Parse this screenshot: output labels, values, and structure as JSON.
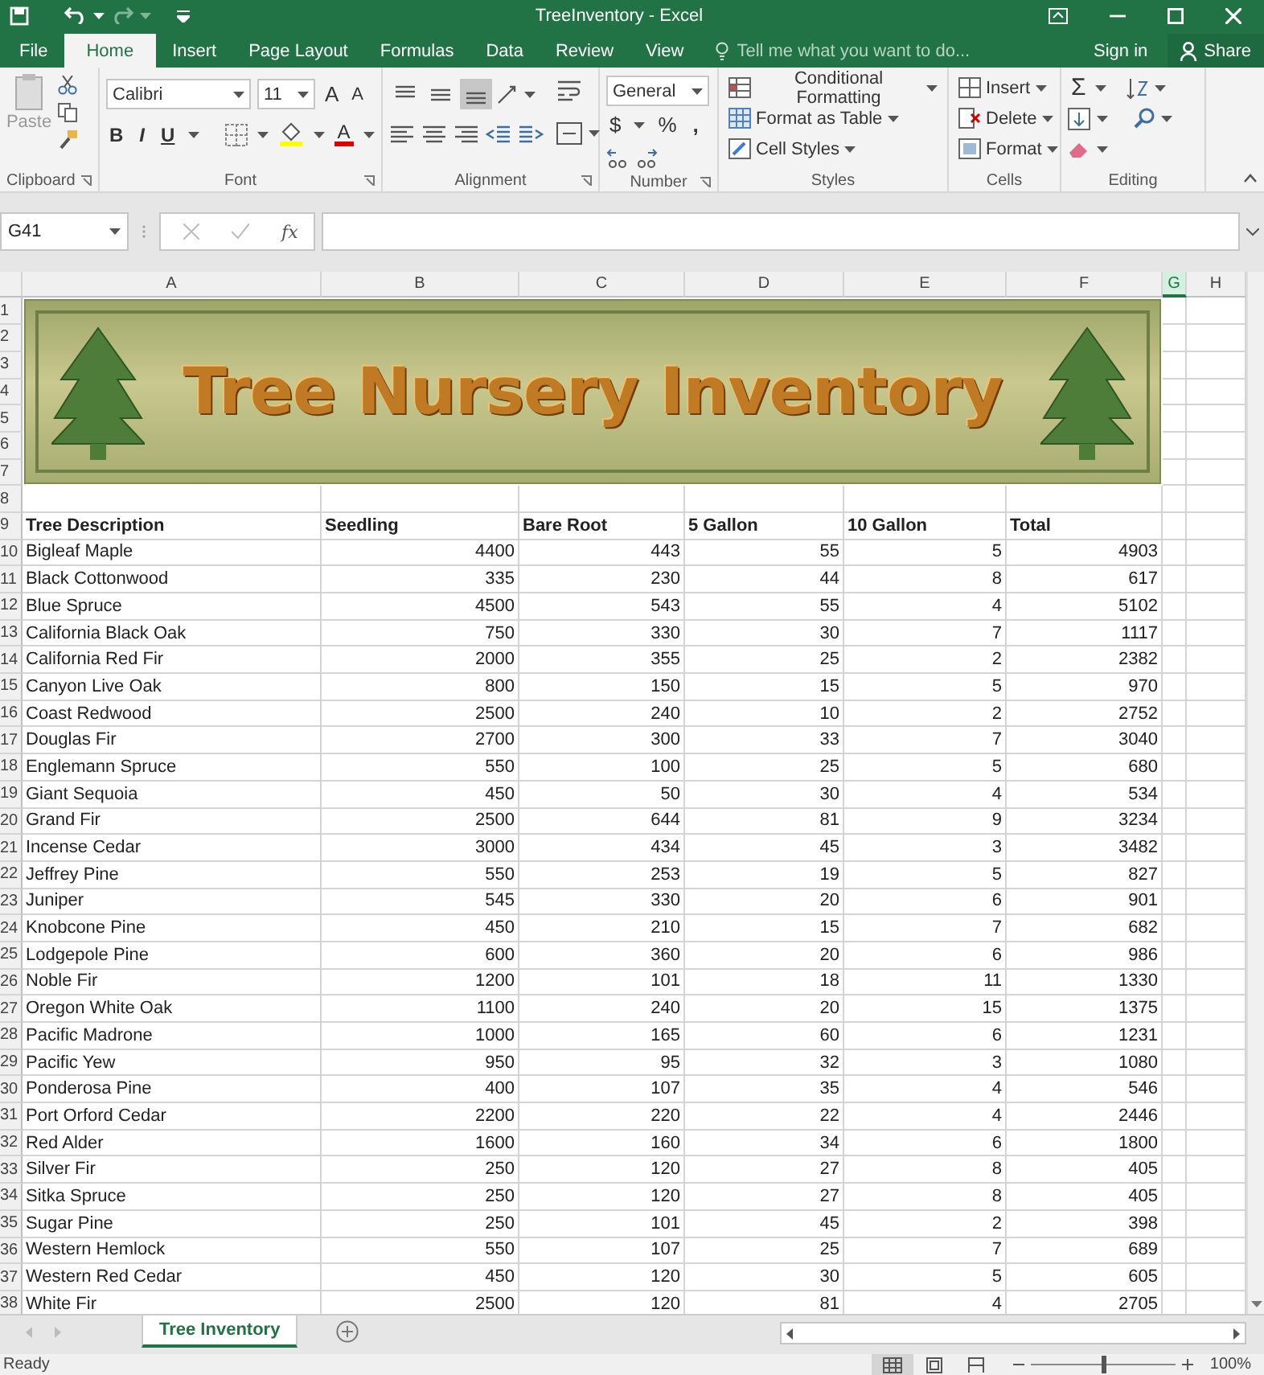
{
  "window": {
    "title": "TreeInventory - Excel"
  },
  "ribbon_tabs": [
    {
      "label": "File",
      "selected": false
    },
    {
      "label": "Home",
      "selected": true
    },
    {
      "label": "Insert",
      "selected": false
    },
    {
      "label": "Page Layout",
      "selected": false
    },
    {
      "label": "Formulas",
      "selected": false
    },
    {
      "label": "Data",
      "selected": false
    },
    {
      "label": "Review",
      "selected": false
    },
    {
      "label": "View",
      "selected": false
    }
  ],
  "tell_me": {
    "placeholder": "Tell me what you want to do..."
  },
  "account": {
    "sign_in": "Sign in",
    "share": "Share"
  },
  "ribbon": {
    "clipboard": {
      "label": "Clipboard",
      "paste": "Paste"
    },
    "font": {
      "label": "Font",
      "font_name": "Calibri",
      "font_size": "11",
      "grow": "A",
      "shrink": "A",
      "bold": "B",
      "italic": "I",
      "underline": "U",
      "font_color": "A"
    },
    "alignment": {
      "label": "Alignment",
      "vertical": [
        {
          "selected": false
        },
        {
          "selected": false
        },
        {
          "selected": true
        }
      ]
    },
    "number": {
      "label": "Number",
      "format": "General",
      "currency": "$",
      "percent": "%",
      "comma": ","
    },
    "styles": {
      "label": "Styles",
      "buttons": [
        "Conditional Formatting",
        "Format as Table",
        "Cell Styles"
      ]
    },
    "cells": {
      "label": "Cells",
      "buttons": [
        "Insert",
        "Delete",
        "Format"
      ]
    },
    "editing": {
      "label": "Editing",
      "autosum": "Σ"
    }
  },
  "formula_bar": {
    "name_box": "G41",
    "function": "fx"
  },
  "sheet": {
    "columns": [
      {
        "label": "A",
        "selected": false
      },
      {
        "label": "B",
        "selected": false
      },
      {
        "label": "C",
        "selected": false
      },
      {
        "label": "D",
        "selected": false
      },
      {
        "label": "E",
        "selected": false
      },
      {
        "label": "F",
        "selected": false
      },
      {
        "label": "G",
        "selected": true
      },
      {
        "label": "H",
        "selected": false
      }
    ],
    "banner": {
      "title": "Tree Nursery Inventory"
    },
    "rows": [
      {
        "number": "1",
        "kind": "empty"
      },
      {
        "number": "2",
        "kind": "empty"
      },
      {
        "number": "3",
        "kind": "empty"
      },
      {
        "number": "4",
        "kind": "empty"
      },
      {
        "number": "5",
        "kind": "empty"
      },
      {
        "number": "6",
        "kind": "empty"
      },
      {
        "number": "7",
        "kind": "empty"
      },
      {
        "number": "8",
        "kind": "empty"
      },
      {
        "number": "9",
        "kind": "header",
        "cells": [
          "Tree Description",
          "Seedling",
          "Bare Root",
          "5 Gallon",
          "10 Gallon",
          "Total"
        ]
      },
      {
        "number": "10",
        "kind": "data",
        "cells": [
          "Bigleaf Maple",
          "4400",
          "443",
          "55",
          "5",
          "4903"
        ]
      },
      {
        "number": "11",
        "kind": "data",
        "cells": [
          "Black Cottonwood",
          "335",
          "230",
          "44",
          "8",
          "617"
        ]
      },
      {
        "number": "12",
        "kind": "data",
        "cells": [
          "Blue Spruce",
          "4500",
          "543",
          "55",
          "4",
          "5102"
        ]
      },
      {
        "number": "13",
        "kind": "data",
        "cells": [
          "California Black Oak",
          "750",
          "330",
          "30",
          "7",
          "1117"
        ]
      },
      {
        "number": "14",
        "kind": "data",
        "cells": [
          "California Red Fir",
          "2000",
          "355",
          "25",
          "2",
          "2382"
        ]
      },
      {
        "number": "15",
        "kind": "data",
        "cells": [
          "Canyon Live Oak",
          "800",
          "150",
          "15",
          "5",
          "970"
        ]
      },
      {
        "number": "16",
        "kind": "data",
        "cells": [
          "Coast Redwood",
          "2500",
          "240",
          "10",
          "2",
          "2752"
        ]
      },
      {
        "number": "17",
        "kind": "data",
        "cells": [
          "Douglas Fir",
          "2700",
          "300",
          "33",
          "7",
          "3040"
        ]
      },
      {
        "number": "18",
        "kind": "data",
        "cells": [
          "Englemann Spruce",
          "550",
          "100",
          "25",
          "5",
          "680"
        ]
      },
      {
        "number": "19",
        "kind": "data",
        "cells": [
          "Giant Sequoia",
          "450",
          "50",
          "30",
          "4",
          "534"
        ]
      },
      {
        "number": "20",
        "kind": "data",
        "cells": [
          "Grand Fir",
          "2500",
          "644",
          "81",
          "9",
          "3234"
        ]
      },
      {
        "number": "21",
        "kind": "data",
        "cells": [
          "Incense Cedar",
          "3000",
          "434",
          "45",
          "3",
          "3482"
        ]
      },
      {
        "number": "22",
        "kind": "data",
        "cells": [
          "Jeffrey Pine",
          "550",
          "253",
          "19",
          "5",
          "827"
        ]
      },
      {
        "number": "23",
        "kind": "data",
        "cells": [
          "Juniper",
          "545",
          "330",
          "20",
          "6",
          "901"
        ]
      },
      {
        "number": "24",
        "kind": "data",
        "cells": [
          "Knobcone Pine",
          "450",
          "210",
          "15",
          "7",
          "682"
        ]
      },
      {
        "number": "25",
        "kind": "data",
        "cells": [
          "Lodgepole Pine",
          "600",
          "360",
          "20",
          "6",
          "986"
        ]
      },
      {
        "number": "26",
        "kind": "data",
        "cells": [
          "Noble Fir",
          "1200",
          "101",
          "18",
          "11",
          "1330"
        ]
      },
      {
        "number": "27",
        "kind": "data",
        "cells": [
          "Oregon White Oak",
          "1100",
          "240",
          "20",
          "15",
          "1375"
        ]
      },
      {
        "number": "28",
        "kind": "data",
        "cells": [
          "Pacific Madrone",
          "1000",
          "165",
          "60",
          "6",
          "1231"
        ]
      },
      {
        "number": "29",
        "kind": "data",
        "cells": [
          "Pacific Yew",
          "950",
          "95",
          "32",
          "3",
          "1080"
        ]
      },
      {
        "number": "30",
        "kind": "data",
        "cells": [
          "Ponderosa Pine",
          "400",
          "107",
          "35",
          "4",
          "546"
        ]
      },
      {
        "number": "31",
        "kind": "data",
        "cells": [
          "Port Orford Cedar",
          "2200",
          "220",
          "22",
          "4",
          "2446"
        ]
      },
      {
        "number": "32",
        "kind": "data",
        "cells": [
          "Red Alder",
          "1600",
          "160",
          "34",
          "6",
          "1800"
        ]
      },
      {
        "number": "33",
        "kind": "data",
        "cells": [
          "Silver Fir",
          "250",
          "120",
          "27",
          "8",
          "405"
        ]
      },
      {
        "number": "34",
        "kind": "data",
        "cells": [
          "Sitka Spruce",
          "250",
          "120",
          "27",
          "8",
          "405"
        ]
      },
      {
        "number": "35",
        "kind": "data",
        "cells": [
          "Sugar Pine",
          "250",
          "101",
          "45",
          "2",
          "398"
        ]
      },
      {
        "number": "36",
        "kind": "data",
        "cells": [
          "Western Hemlock",
          "550",
          "107",
          "25",
          "7",
          "689"
        ]
      },
      {
        "number": "37",
        "kind": "data",
        "cells": [
          "Western Red Cedar",
          "450",
          "120",
          "30",
          "5",
          "605"
        ]
      },
      {
        "number": "38",
        "kind": "data",
        "cells": [
          "White Fir",
          "2500",
          "120",
          "81",
          "4",
          "2705"
        ]
      }
    ]
  },
  "sheet_tabs": [
    {
      "label": "Tree Inventory",
      "selected": true
    }
  ],
  "status_bar": {
    "status": "Ready",
    "views": [
      {
        "selected": true
      },
      {
        "selected": false
      },
      {
        "selected": false
      }
    ],
    "zoom": {
      "level": 0.5,
      "reading": "100%"
    }
  }
}
